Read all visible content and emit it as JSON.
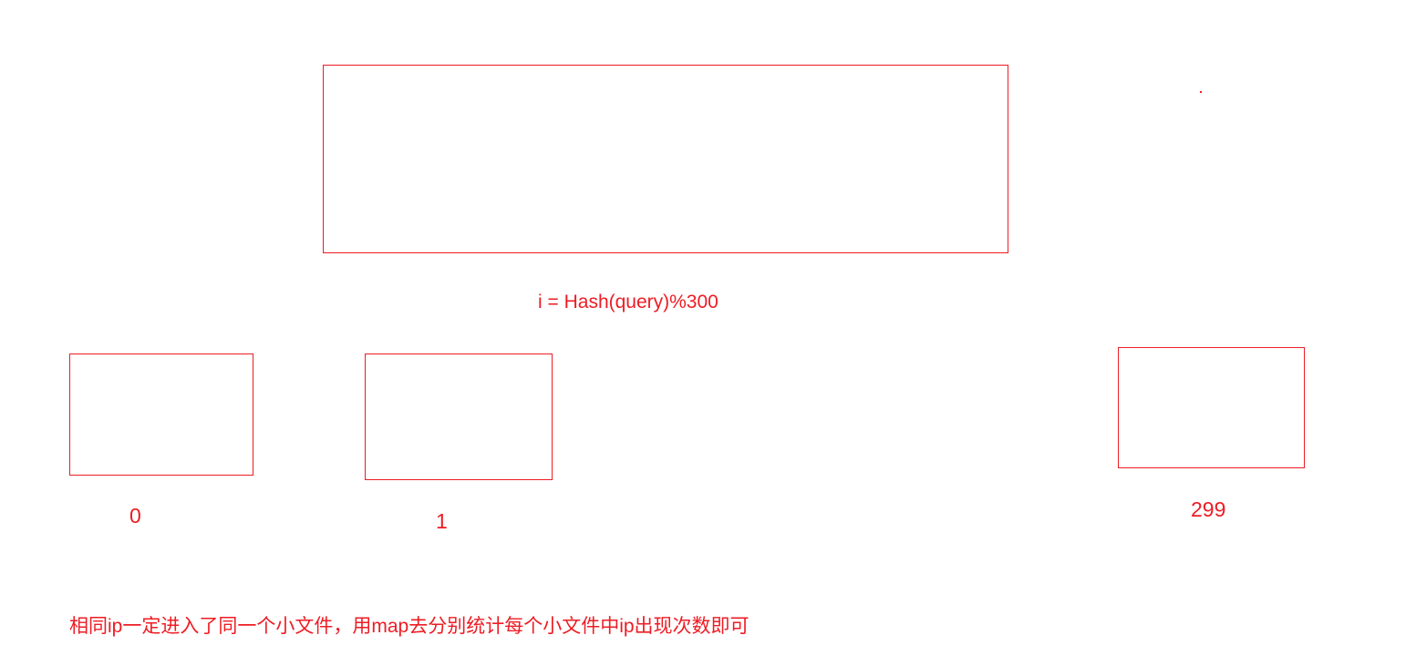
{
  "diagram": {
    "hash_formula": "i = Hash(query)%300",
    "boxes": {
      "box0_label": "0",
      "box1_label": "1",
      "box299_label": "299"
    },
    "description": "相同ip一定进入了同一个小文件，用map去分别统计每个小文件中ip出现次数即可"
  },
  "colors": {
    "stroke": "#ed1c24",
    "text": "#ed1c24",
    "background": "#ffffff"
  }
}
